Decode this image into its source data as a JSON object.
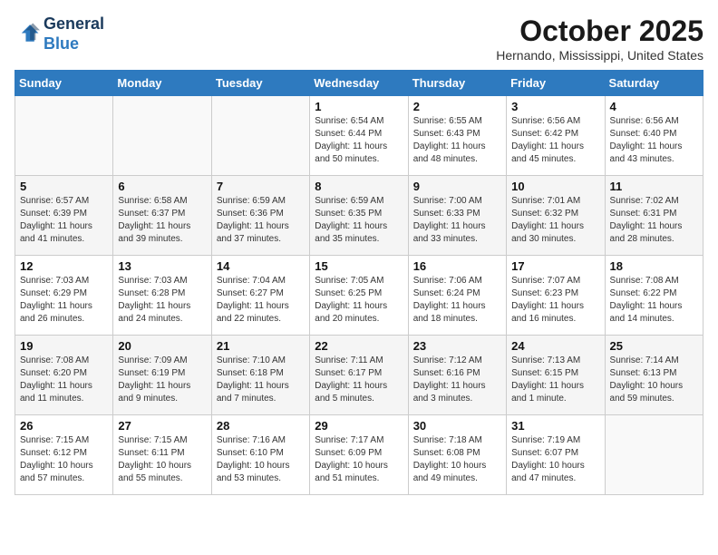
{
  "header": {
    "logo_line1": "General",
    "logo_line2": "Blue",
    "month": "October 2025",
    "location": "Hernando, Mississippi, United States"
  },
  "weekdays": [
    "Sunday",
    "Monday",
    "Tuesday",
    "Wednesday",
    "Thursday",
    "Friday",
    "Saturday"
  ],
  "weeks": [
    [
      {
        "day": "",
        "info": ""
      },
      {
        "day": "",
        "info": ""
      },
      {
        "day": "",
        "info": ""
      },
      {
        "day": "1",
        "info": "Sunrise: 6:54 AM\nSunset: 6:44 PM\nDaylight: 11 hours\nand 50 minutes."
      },
      {
        "day": "2",
        "info": "Sunrise: 6:55 AM\nSunset: 6:43 PM\nDaylight: 11 hours\nand 48 minutes."
      },
      {
        "day": "3",
        "info": "Sunrise: 6:56 AM\nSunset: 6:42 PM\nDaylight: 11 hours\nand 45 minutes."
      },
      {
        "day": "4",
        "info": "Sunrise: 6:56 AM\nSunset: 6:40 PM\nDaylight: 11 hours\nand 43 minutes."
      }
    ],
    [
      {
        "day": "5",
        "info": "Sunrise: 6:57 AM\nSunset: 6:39 PM\nDaylight: 11 hours\nand 41 minutes."
      },
      {
        "day": "6",
        "info": "Sunrise: 6:58 AM\nSunset: 6:37 PM\nDaylight: 11 hours\nand 39 minutes."
      },
      {
        "day": "7",
        "info": "Sunrise: 6:59 AM\nSunset: 6:36 PM\nDaylight: 11 hours\nand 37 minutes."
      },
      {
        "day": "8",
        "info": "Sunrise: 6:59 AM\nSunset: 6:35 PM\nDaylight: 11 hours\nand 35 minutes."
      },
      {
        "day": "9",
        "info": "Sunrise: 7:00 AM\nSunset: 6:33 PM\nDaylight: 11 hours\nand 33 minutes."
      },
      {
        "day": "10",
        "info": "Sunrise: 7:01 AM\nSunset: 6:32 PM\nDaylight: 11 hours\nand 30 minutes."
      },
      {
        "day": "11",
        "info": "Sunrise: 7:02 AM\nSunset: 6:31 PM\nDaylight: 11 hours\nand 28 minutes."
      }
    ],
    [
      {
        "day": "12",
        "info": "Sunrise: 7:03 AM\nSunset: 6:29 PM\nDaylight: 11 hours\nand 26 minutes."
      },
      {
        "day": "13",
        "info": "Sunrise: 7:03 AM\nSunset: 6:28 PM\nDaylight: 11 hours\nand 24 minutes."
      },
      {
        "day": "14",
        "info": "Sunrise: 7:04 AM\nSunset: 6:27 PM\nDaylight: 11 hours\nand 22 minutes."
      },
      {
        "day": "15",
        "info": "Sunrise: 7:05 AM\nSunset: 6:25 PM\nDaylight: 11 hours\nand 20 minutes."
      },
      {
        "day": "16",
        "info": "Sunrise: 7:06 AM\nSunset: 6:24 PM\nDaylight: 11 hours\nand 18 minutes."
      },
      {
        "day": "17",
        "info": "Sunrise: 7:07 AM\nSunset: 6:23 PM\nDaylight: 11 hours\nand 16 minutes."
      },
      {
        "day": "18",
        "info": "Sunrise: 7:08 AM\nSunset: 6:22 PM\nDaylight: 11 hours\nand 14 minutes."
      }
    ],
    [
      {
        "day": "19",
        "info": "Sunrise: 7:08 AM\nSunset: 6:20 PM\nDaylight: 11 hours\nand 11 minutes."
      },
      {
        "day": "20",
        "info": "Sunrise: 7:09 AM\nSunset: 6:19 PM\nDaylight: 11 hours\nand 9 minutes."
      },
      {
        "day": "21",
        "info": "Sunrise: 7:10 AM\nSunset: 6:18 PM\nDaylight: 11 hours\nand 7 minutes."
      },
      {
        "day": "22",
        "info": "Sunrise: 7:11 AM\nSunset: 6:17 PM\nDaylight: 11 hours\nand 5 minutes."
      },
      {
        "day": "23",
        "info": "Sunrise: 7:12 AM\nSunset: 6:16 PM\nDaylight: 11 hours\nand 3 minutes."
      },
      {
        "day": "24",
        "info": "Sunrise: 7:13 AM\nSunset: 6:15 PM\nDaylight: 11 hours\nand 1 minute."
      },
      {
        "day": "25",
        "info": "Sunrise: 7:14 AM\nSunset: 6:13 PM\nDaylight: 10 hours\nand 59 minutes."
      }
    ],
    [
      {
        "day": "26",
        "info": "Sunrise: 7:15 AM\nSunset: 6:12 PM\nDaylight: 10 hours\nand 57 minutes."
      },
      {
        "day": "27",
        "info": "Sunrise: 7:15 AM\nSunset: 6:11 PM\nDaylight: 10 hours\nand 55 minutes."
      },
      {
        "day": "28",
        "info": "Sunrise: 7:16 AM\nSunset: 6:10 PM\nDaylight: 10 hours\nand 53 minutes."
      },
      {
        "day": "29",
        "info": "Sunrise: 7:17 AM\nSunset: 6:09 PM\nDaylight: 10 hours\nand 51 minutes."
      },
      {
        "day": "30",
        "info": "Sunrise: 7:18 AM\nSunset: 6:08 PM\nDaylight: 10 hours\nand 49 minutes."
      },
      {
        "day": "31",
        "info": "Sunrise: 7:19 AM\nSunset: 6:07 PM\nDaylight: 10 hours\nand 47 minutes."
      },
      {
        "day": "",
        "info": ""
      }
    ]
  ]
}
